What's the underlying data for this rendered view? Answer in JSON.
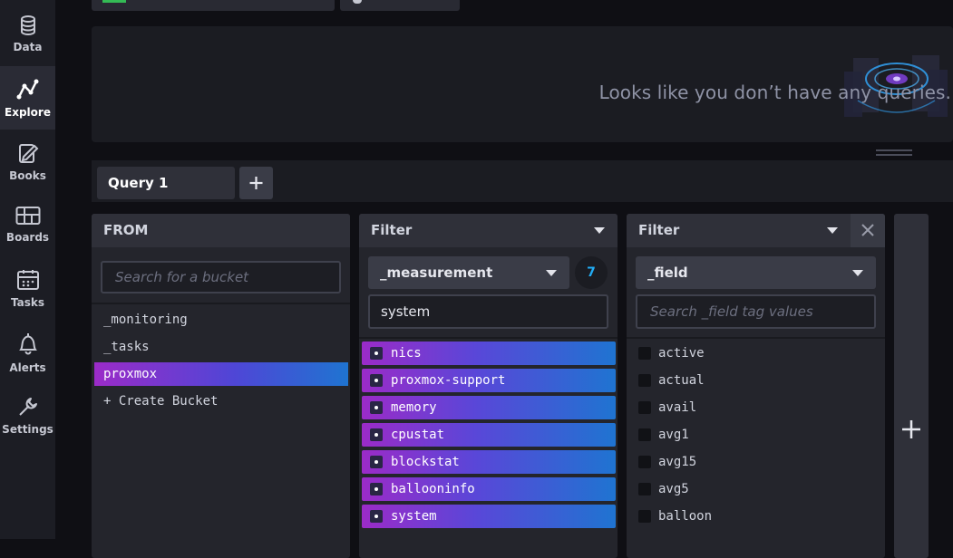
{
  "sidebar": {
    "items": [
      {
        "label": "Data",
        "icon": "database-icon"
      },
      {
        "label": "Explore",
        "icon": "explore-icon"
      },
      {
        "label": "Books",
        "icon": "notebook-icon"
      },
      {
        "label": "Boards",
        "icon": "dashboard-icon"
      },
      {
        "label": "Tasks",
        "icon": "calendar-icon"
      },
      {
        "label": "Alerts",
        "icon": "bell-icon"
      },
      {
        "label": "Settings",
        "icon": "wrench-icon"
      }
    ],
    "active": "Explore"
  },
  "graph": {
    "empty_message": "Looks like you don’t have any queries."
  },
  "queries": {
    "tabs": [
      {
        "label": "Query 1"
      }
    ],
    "add_label": "+"
  },
  "from_panel": {
    "header": "FROM",
    "search_placeholder": "Search for a bucket",
    "buckets": [
      "_monitoring",
      "_tasks",
      "proxmox",
      "+ Create Bucket"
    ],
    "selected": "proxmox"
  },
  "filter1": {
    "header": "Filter",
    "key": "_measurement",
    "count": "7",
    "search_value": "system",
    "items": [
      "nics",
      "proxmox-support",
      "memory",
      "cpustat",
      "blockstat",
      "ballooninfo",
      "system"
    ]
  },
  "filter2": {
    "header": "Filter",
    "key": "_field",
    "search_placeholder": "Search _field tag values",
    "items": [
      "active",
      "actual",
      "avail",
      "avg1",
      "avg15",
      "avg5",
      "balloon"
    ]
  },
  "colors": {
    "accent_gradient_start": "#9b2bc8",
    "accent_gradient_end": "#1f74d1",
    "count_badge": "#22adf6"
  }
}
